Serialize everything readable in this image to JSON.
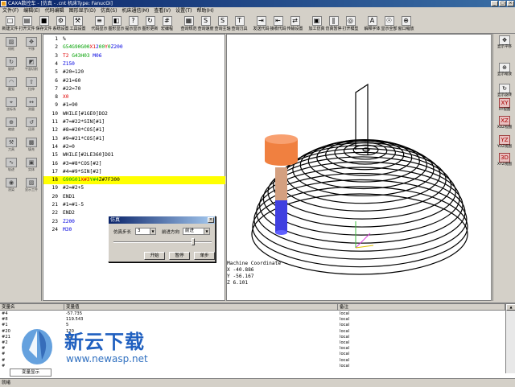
{
  "window": {
    "title": "CAXA数控车 - [仿真 - .cnt  机床Type: FanucOi]",
    "minimize": "_",
    "maximize": "□",
    "close": "×"
  },
  "menu": [
    "文件(F)",
    "编辑(E)",
    "代码编辑",
    "图形显示(D)",
    "仿真(S)",
    "机床通信(M)",
    "查看(V)",
    "设置(T)",
    "帮助(H)"
  ],
  "toolbar": [
    {
      "label": "新建文件",
      "icon": "new-file-icon",
      "glyph": "□"
    },
    {
      "label": "打开文件",
      "icon": "open-folder-icon",
      "glyph": "▤"
    },
    {
      "label": "保存文件",
      "icon": "save-icon",
      "glyph": "■"
    },
    {
      "label": "系统设置",
      "icon": "system-settings-icon",
      "glyph": "⚙"
    },
    {
      "label": "工具设置",
      "icon": "tool-settings-icon",
      "glyph": "⚒"
    },
    {
      "label": "代码显示",
      "icon": "code-display-icon",
      "glyph": "≡"
    },
    {
      "label": "图形显示",
      "icon": "graph-display-icon",
      "glyph": "◧"
    },
    {
      "label": "提示显示",
      "icon": "hint-display-icon",
      "glyph": "?"
    },
    {
      "label": "图形更新",
      "icon": "graph-refresh-icon",
      "glyph": "↻"
    },
    {
      "label": "宏编程",
      "icon": "macro-icon",
      "glyph": "#"
    },
    {
      "label": "查询规范",
      "icon": "query-spec-icon",
      "glyph": "▦"
    },
    {
      "label": "查询速度",
      "icon": "query-speed-icon",
      "glyph": "S"
    },
    {
      "label": "查询主轴",
      "icon": "query-spindle-icon",
      "glyph": "S"
    },
    {
      "label": "查询刀具",
      "icon": "query-tool-icon",
      "glyph": "T"
    },
    {
      "label": "发送代码",
      "icon": "send-code-icon",
      "glyph": "⇥"
    },
    {
      "label": "接收代码",
      "icon": "receive-code-icon",
      "glyph": "⇤"
    },
    {
      "label": "传输设置",
      "icon": "transfer-settings-icon",
      "glyph": "⇄"
    },
    {
      "label": "加工仿真",
      "icon": "machining-sim-icon",
      "glyph": "▣"
    },
    {
      "label": "仿真暂停",
      "icon": "sim-pause-icon",
      "glyph": "‖"
    },
    {
      "label": "打开模型",
      "icon": "open-model-icon",
      "glyph": "◎"
    },
    {
      "label": "解释字体",
      "icon": "font-icon",
      "glyph": "A"
    },
    {
      "label": "显示全部",
      "icon": "show-all-icon",
      "glyph": "☉"
    },
    {
      "label": "窗口缩放",
      "icon": "window-zoom-icon",
      "glyph": "⊕"
    }
  ],
  "left_tools": [
    "线框",
    "平移",
    "旋转",
    "平面切削",
    "圆弧",
    "拉伸",
    "坐标系",
    "测量",
    "缩放",
    "还原",
    "刀具",
    "填充",
    "轨迹",
    "实体",
    "渲染",
    "显示工件"
  ],
  "right_tools": [
    {
      "label": "显示平移",
      "glyph": "✥",
      "red": false
    },
    {
      "label": "显示缩放",
      "glyph": "⊕",
      "red": false
    },
    {
      "label": "显示旋转",
      "glyph": "↻",
      "red": false
    },
    {
      "label": "XY视图",
      "glyph": "XY",
      "red": true
    },
    {
      "label": "XOZ视图",
      "glyph": "XZ",
      "red": true
    },
    {
      "label": "YOZ视图",
      "glyph": "YZ",
      "red": true
    },
    {
      "label": "XYZ视图",
      "glyph": "3D",
      "red": true
    }
  ],
  "code_lines": [
    {
      "n": "1",
      "segs": [
        {
          "t": "%",
          "c": "d"
        }
      ]
    },
    {
      "n": "2",
      "segs": [
        {
          "t": "G54G90G00",
          "c": "g"
        },
        {
          "t": "X1",
          "c": "r"
        },
        {
          "t": "2",
          "c": "b"
        },
        {
          "t": "00",
          "c": "g"
        },
        {
          "t": "Y",
          "c": "r"
        },
        {
          "t": "0",
          "c": "g"
        },
        {
          "t": "Z200",
          "c": "b"
        }
      ]
    },
    {
      "n": "3",
      "segs": [
        {
          "t": "T2 ",
          "c": "r"
        },
        {
          "t": "G43H03 ",
          "c": "g"
        },
        {
          "t": "M06",
          "c": "b"
        }
      ]
    },
    {
      "n": "4",
      "segs": [
        {
          "t": "Z150",
          "c": "b"
        }
      ]
    },
    {
      "n": "5",
      "segs": [
        {
          "t": "#20=120",
          "c": "d"
        }
      ]
    },
    {
      "n": "6",
      "segs": [
        {
          "t": "#21=60",
          "c": "d"
        }
      ]
    },
    {
      "n": "7",
      "segs": [
        {
          "t": "#22=70",
          "c": "d"
        }
      ]
    },
    {
      "n": "8",
      "segs": [
        {
          "t": "X0",
          "c": "r"
        }
      ]
    },
    {
      "n": "9",
      "segs": [
        {
          "t": "#1=90",
          "c": "d"
        }
      ]
    },
    {
      "n": "10",
      "segs": [
        {
          "t": "WHILE[#1GE0]DO2",
          "c": "d"
        }
      ]
    },
    {
      "n": "11",
      "segs": [
        {
          "t": "#7=#22*SIN[#1]",
          "c": "d"
        }
      ]
    },
    {
      "n": "12",
      "segs": [
        {
          "t": "#8=#20*COS[#1]",
          "c": "d"
        }
      ]
    },
    {
      "n": "13",
      "segs": [
        {
          "t": "#9=#21*COS[#1]",
          "c": "d"
        }
      ]
    },
    {
      "n": "14",
      "segs": [
        {
          "t": "#2=0",
          "c": "d"
        }
      ]
    },
    {
      "n": "15",
      "segs": [
        {
          "t": "WHILE[#2LE360]DO1",
          "c": "d"
        }
      ]
    },
    {
      "n": "16",
      "segs": [
        {
          "t": "#3=#8*COS[#2]",
          "c": "d"
        }
      ]
    },
    {
      "n": "17",
      "segs": [
        {
          "t": "#4=#9*SIN[#2]",
          "c": "d"
        }
      ]
    },
    {
      "n": "18",
      "segs": [
        {
          "t": "G90G01",
          "c": "g"
        },
        {
          "t": "X#3",
          "c": "r"
        },
        {
          "t": "Y#4",
          "c": "g"
        },
        {
          "t": "Z#7F300",
          "c": "d"
        }
      ],
      "hl": true
    },
    {
      "n": "19",
      "segs": [
        {
          "t": "#2=#2+5",
          "c": "d"
        }
      ]
    },
    {
      "n": "20",
      "segs": [
        {
          "t": "END1",
          "c": "d"
        }
      ]
    },
    {
      "n": "21",
      "segs": [
        {
          "t": "#1=#1-5",
          "c": "d"
        }
      ]
    },
    {
      "n": "22",
      "segs": [
        {
          "t": "END2",
          "c": "d"
        }
      ]
    },
    {
      "n": "23",
      "segs": [
        {
          "t": "Z200",
          "c": "b"
        }
      ]
    },
    {
      "n": "24",
      "segs": [
        {
          "t": "M30",
          "c": "b"
        }
      ]
    }
  ],
  "coords": {
    "title": "Machine Coordinate",
    "x": "X -40.886",
    "y": "Y -56.167",
    "z": "Z 6.101"
  },
  "dialog": {
    "title": "仿真",
    "step_label": "仿真步长",
    "step_value": "3",
    "direction_label": "前进方向",
    "direction_value": "前进",
    "slider_position": 0.82,
    "start": "开始",
    "pause": "暂停",
    "single_step": "单步",
    "close": "×"
  },
  "var_panel": {
    "headers": [
      "变量名",
      "变量值",
      "备注"
    ],
    "rows": [
      {
        "name": "#4",
        "value": "-57.735",
        "note": "local"
      },
      {
        "name": "#8",
        "value": "119.543",
        "note": "local"
      },
      {
        "name": "#1",
        "value": "5",
        "note": "local"
      },
      {
        "name": "#20",
        "value": "120",
        "note": "local"
      },
      {
        "name": "#21",
        "value": "60",
        "note": "local"
      },
      {
        "name": "#2",
        "value": "",
        "note": "local"
      },
      {
        "name": "#",
        "value": "",
        "note": "local"
      },
      {
        "name": "#",
        "value": "",
        "note": "local"
      },
      {
        "name": "#",
        "value": "",
        "note": "local"
      },
      {
        "name": "#",
        "value": "",
        "note": "local"
      }
    ],
    "tab": "变量显示"
  },
  "watermark": {
    "brand": "新云下载",
    "url": "www.newasp.net"
  },
  "status": "就绪",
  "colors": {
    "highlight": "#ffff00",
    "tool_top": "#f08040",
    "tool_shank": "#d4a080",
    "tool_tip": "#4040e0",
    "code_red": "#e00000",
    "code_green": "#00a000",
    "code_blue": "#0000e0"
  }
}
